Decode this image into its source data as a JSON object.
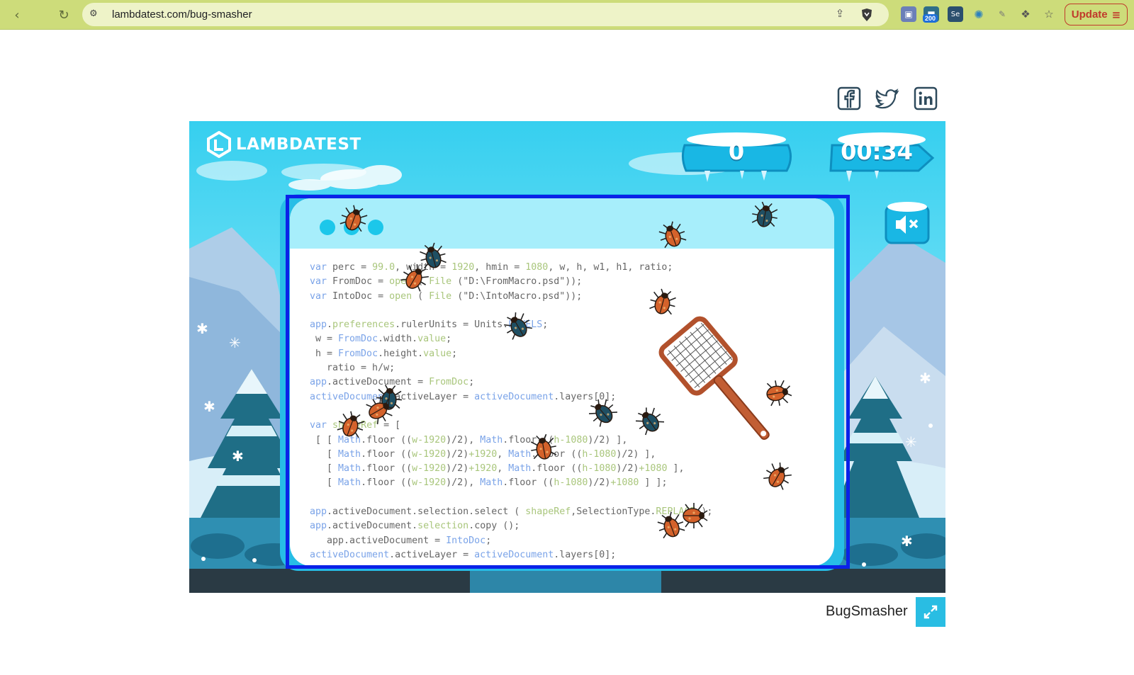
{
  "browser": {
    "url": "lambdatest.com/bug-smasher",
    "update_label": "Update",
    "extension_badge": "200",
    "ext_icons": [
      "wappalyzer-icon",
      "badge-counter-icon",
      "selenium-ide-icon",
      "openai-icon",
      "pen-icon",
      "puzzle-icon",
      "bookmark-star-icon"
    ]
  },
  "social": [
    "facebook-icon",
    "twitter-icon",
    "linkedin-icon"
  ],
  "game": {
    "logo_text": "LAMBDATEST",
    "score": "0",
    "timer": "00:34",
    "sound": "muted",
    "code_lines": [
      [
        [
          "k",
          "var"
        ],
        [
          "s",
          " perc = "
        ],
        [
          "n",
          "99.0"
        ],
        [
          "s",
          ", w"
        ],
        [
          "s",
          "idth = "
        ],
        [
          "n",
          "1920"
        ],
        [
          "s",
          ", hmin = "
        ],
        [
          "n",
          "1080"
        ],
        [
          "s",
          ", w, h, w1, h1, ratio;"
        ]
      ],
      [
        [
          "k",
          "var"
        ],
        [
          "s",
          " FromDoc = "
        ],
        [
          "n",
          "open"
        ],
        [
          "s",
          " ( "
        ],
        [
          "n",
          "File"
        ],
        [
          "s",
          " (\"D:\\FromMacro.psd\"));"
        ]
      ],
      [
        [
          "k",
          "var"
        ],
        [
          "s",
          " IntoDoc = "
        ],
        [
          "n",
          "open"
        ],
        [
          "s",
          " ( "
        ],
        [
          "n",
          "File"
        ],
        [
          "s",
          " (\"D:\\IntoMacro.psd\"));"
        ]
      ],
      [],
      [
        [
          "k",
          "app"
        ],
        [
          "s",
          "."
        ],
        [
          "n",
          "preferences"
        ],
        [
          "s",
          ".rulerUnits = Units."
        ],
        [
          "k",
          "PIXELS"
        ],
        [
          "s",
          ";"
        ]
      ],
      [
        [
          "s",
          " w = "
        ],
        [
          "k",
          "FromDoc"
        ],
        [
          "s",
          ".width."
        ],
        [
          "n",
          "value"
        ],
        [
          "s",
          ";"
        ]
      ],
      [
        [
          "s",
          " h = "
        ],
        [
          "k",
          "FromDoc"
        ],
        [
          "s",
          ".height."
        ],
        [
          "n",
          "value"
        ],
        [
          "s",
          ";"
        ]
      ],
      [
        [
          "s",
          "   ratio = h/w;"
        ]
      ],
      [
        [
          "k",
          "app"
        ],
        [
          "s",
          ".activeDocument = "
        ],
        [
          "n",
          "FromDoc"
        ],
        [
          "s",
          ";"
        ]
      ],
      [
        [
          "k",
          "activeDocument"
        ],
        [
          "s",
          ".activeLayer = "
        ],
        [
          "k",
          "activeDocument"
        ],
        [
          "s",
          ".layers[0];"
        ]
      ],
      [],
      [
        [
          "k",
          "var"
        ],
        [
          "s",
          " "
        ],
        [
          "n",
          "shapeRef"
        ],
        [
          "s",
          " = ["
        ]
      ],
      [
        [
          "s",
          " [ [ "
        ],
        [
          "k",
          "Math"
        ],
        [
          "s",
          ".floor (("
        ],
        [
          "n",
          "w-1920"
        ],
        [
          "s",
          ")/2), "
        ],
        [
          "k",
          "Math"
        ],
        [
          "s",
          ".floor (("
        ],
        [
          "n",
          "h-1080"
        ],
        [
          "s",
          ")/2) ],"
        ]
      ],
      [
        [
          "s",
          "   [ "
        ],
        [
          "k",
          "Math"
        ],
        [
          "s",
          ".floor (("
        ],
        [
          "n",
          "w-1920"
        ],
        [
          "s",
          ")/2)"
        ],
        [
          "n",
          "+1920"
        ],
        [
          "s",
          ", "
        ],
        [
          "k",
          "Math"
        ],
        [
          "s",
          ".floor (("
        ],
        [
          "n",
          "h-1080"
        ],
        [
          "s",
          ")/2) ],"
        ]
      ],
      [
        [
          "s",
          "   [ "
        ],
        [
          "k",
          "Math"
        ],
        [
          "s",
          ".floor (("
        ],
        [
          "n",
          "w-1920"
        ],
        [
          "s",
          ")/2)"
        ],
        [
          "n",
          "+1920"
        ],
        [
          "s",
          ", "
        ],
        [
          "k",
          "Math"
        ],
        [
          "s",
          ".floor (("
        ],
        [
          "n",
          "h-1080"
        ],
        [
          "s",
          ")/2)"
        ],
        [
          "n",
          "+1080"
        ],
        [
          "s",
          " ],"
        ]
      ],
      [
        [
          "s",
          "   [ "
        ],
        [
          "k",
          "Math"
        ],
        [
          "s",
          ".floor (("
        ],
        [
          "n",
          "w-1920"
        ],
        [
          "s",
          ")/2), "
        ],
        [
          "k",
          "Math"
        ],
        [
          "s",
          ".floor (("
        ],
        [
          "n",
          "h-1080"
        ],
        [
          "s",
          ")/2)"
        ],
        [
          "n",
          "+1080"
        ],
        [
          "s",
          " ] ];"
        ]
      ],
      [],
      [
        [
          "k",
          "app"
        ],
        [
          "s",
          ".activeDocument.selection.select ( "
        ],
        [
          "n",
          "shapeRef"
        ],
        [
          "s",
          ",SelectionType."
        ],
        [
          "n",
          "REPLACE"
        ],
        [
          "s",
          " );"
        ]
      ],
      [
        [
          "k",
          "app"
        ],
        [
          "s",
          ".activeDocument."
        ],
        [
          "n",
          "selection"
        ],
        [
          "s",
          ".copy ();"
        ]
      ],
      [
        [
          "s",
          "   app.activeDocument = "
        ],
        [
          "k",
          "IntoDoc"
        ],
        [
          "s",
          ";"
        ]
      ],
      [
        [
          "k",
          "activeDocument"
        ],
        [
          "s",
          ".activeLayer = "
        ],
        [
          "k",
          "activeDocument"
        ],
        [
          "s",
          ".layers[0];"
        ]
      ]
    ]
  },
  "footer": {
    "game_name": "BugSmasher",
    "fullscreen_icon": "expand-icon"
  },
  "colors": {
    "chrome": "#cddc7a",
    "game_sky": "#36cfef",
    "card_border": "#27bde6",
    "selection": "#0a22e8",
    "bug_orange": "#d4622b",
    "bug_teal": "#1f4f63"
  }
}
